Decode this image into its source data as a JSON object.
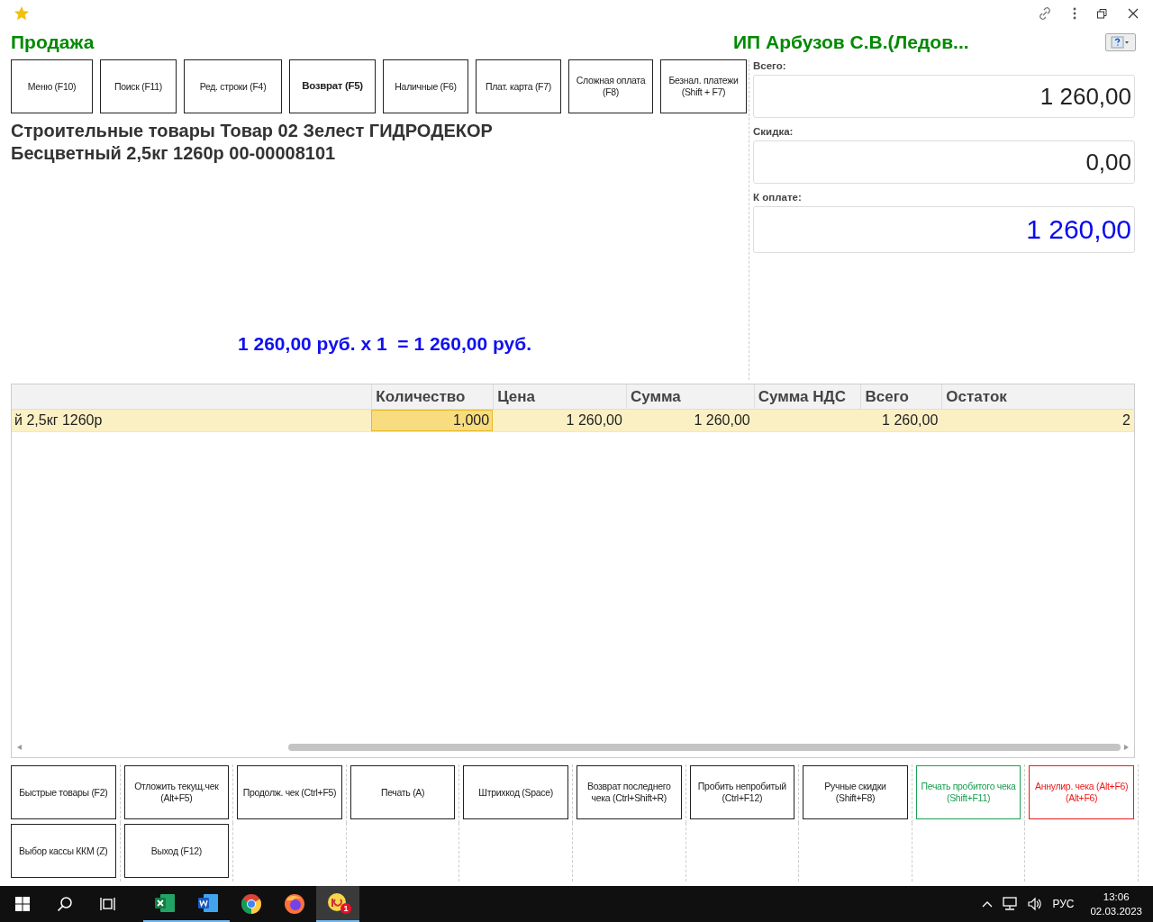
{
  "window": {
    "title": "Продажа",
    "organization": "ИП Арбузов С.В.(Ледов...",
    "favorite": true
  },
  "top_buttons": [
    {
      "label": "Меню (F10)",
      "kind": "plain"
    },
    {
      "label": "Поиск (F11)",
      "kind": "plain"
    },
    {
      "label": "Ред. строки (F4)",
      "kind": "plain"
    },
    {
      "label": "Возврат (F5)",
      "kind": "bold"
    },
    {
      "label": "Наличные (F6)",
      "kind": "plain"
    },
    {
      "label": "Плат. карта (F7)",
      "kind": "plain"
    },
    {
      "label": "Сложная оплата (F8)",
      "kind": "plain"
    },
    {
      "label": "Безнал. платежи (Shift + F7)",
      "kind": "plain"
    }
  ],
  "product": {
    "name": "Строительные товары Товар 02 Зелест ГИДРОДЕКОР Бесцветный 2,5кг 1260р 00-00008101",
    "calculation": "1 260,00 руб. х 1  = 1 260,00 руб."
  },
  "totals": [
    {
      "label": "Всего:",
      "value": "1 260,00",
      "kind": "plain"
    },
    {
      "label": "Скидка:",
      "value": "0,00",
      "kind": "plain"
    },
    {
      "label": "К оплате:",
      "value": "1 260,00",
      "kind": "accent"
    }
  ],
  "table": {
    "columns": [
      "",
      "Количество",
      "Цена",
      "Сумма",
      "Сумма НДС",
      "Всего",
      "Остаток"
    ],
    "rows": [
      {
        "selected": true,
        "cells": [
          {
            "text": "й 2,5кг 1260р",
            "selected": false
          },
          {
            "text": "1,000",
            "selected": true
          },
          {
            "text": "1 260,00",
            "selected": false
          },
          {
            "text": "1 260,00",
            "selected": false
          },
          {
            "text": "",
            "selected": false
          },
          {
            "text": "1 260,00",
            "selected": false
          },
          {
            "text": "2",
            "selected": false
          }
        ]
      }
    ]
  },
  "bottom_buttons": [
    {
      "label": "Быстрые товары (F2)",
      "kind": "plain"
    },
    {
      "label": "Отложить текущ.чек (Alt+F5)",
      "kind": "plain"
    },
    {
      "label": "Продолж. чек (Ctrl+F5)",
      "kind": "plain"
    },
    {
      "label": "Печать (A)",
      "kind": "plain"
    },
    {
      "label": "Штрихкод (Space)",
      "kind": "plain"
    },
    {
      "label": "Возврат последнего чека (Ctrl+Shift+R)",
      "kind": "plain"
    },
    {
      "label": "Пробить непробитый (Ctrl+F12)",
      "kind": "plain"
    },
    {
      "label": "Ручные скидки (Shift+F8)",
      "kind": "plain"
    },
    {
      "label": "Печать пробитого чека (Shift+F11)",
      "kind": "green"
    },
    {
      "label": "Аннулир. чека (Alt+F6) (Alt+F6)",
      "kind": "red"
    },
    {
      "label": "Выбор кассы ККМ (Z)",
      "kind": "plain"
    },
    {
      "label": "Выход (F12)",
      "kind": "plain"
    }
  ],
  "taskbar": {
    "apps": [
      {
        "kind": "excel",
        "running": true,
        "selected": false
      },
      {
        "kind": "word",
        "running": true,
        "selected": false
      },
      {
        "kind": "chrome",
        "running": false,
        "selected": false
      },
      {
        "kind": "firefox",
        "running": false,
        "selected": false
      },
      {
        "kind": "onec",
        "running": true,
        "selected": true,
        "badge": "1"
      }
    ],
    "language": "РУС",
    "time": "13:06",
    "date": "02.03.2023"
  }
}
